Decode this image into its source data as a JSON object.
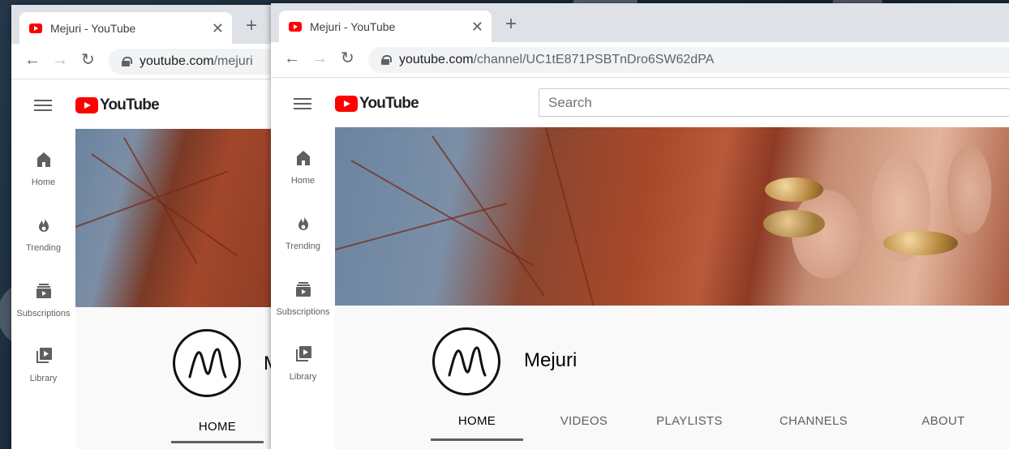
{
  "back_window": {
    "tab": {
      "title": "Mejuri - YouTube",
      "close": "✕"
    },
    "new_tab": "+",
    "url": {
      "host": "youtube.com",
      "path": "/mejuri"
    },
    "yt": {
      "logo_text": "YouTube",
      "guide": [
        {
          "label": "Home",
          "icon": "home-icon"
        },
        {
          "label": "Trending",
          "icon": "flame-icon"
        },
        {
          "label": "Subscriptions",
          "icon": "subscriptions-icon"
        },
        {
          "label": "Library",
          "icon": "library-icon"
        }
      ],
      "channel_name_partial": "M",
      "tabs": [
        "HOME"
      ]
    }
  },
  "front_window": {
    "tab": {
      "title": "Mejuri - YouTube",
      "close": "✕"
    },
    "new_tab": "+",
    "url": {
      "host": "youtube.com",
      "path": "/channel/UC1tE871PSBTnDro6SW62dPA"
    },
    "yt": {
      "logo_text": "YouTube",
      "search_placeholder": "Search",
      "guide": [
        {
          "label": "Home",
          "icon": "home-icon"
        },
        {
          "label": "Trending",
          "icon": "flame-icon"
        },
        {
          "label": "Subscriptions",
          "icon": "subscriptions-icon"
        },
        {
          "label": "Library",
          "icon": "library-icon"
        }
      ],
      "channel_name": "Mejuri",
      "tabs": [
        "HOME",
        "VIDEOS",
        "PLAYLISTS",
        "CHANNELS",
        "ABOUT"
      ],
      "active_tab": "HOME"
    }
  },
  "nav": {
    "back": "←",
    "forward": "→",
    "reload": "↻"
  },
  "colors": {
    "youtube_red": "#ff0000",
    "tabstrip": "#dee1e6",
    "omnibox": "#f1f3f4"
  }
}
